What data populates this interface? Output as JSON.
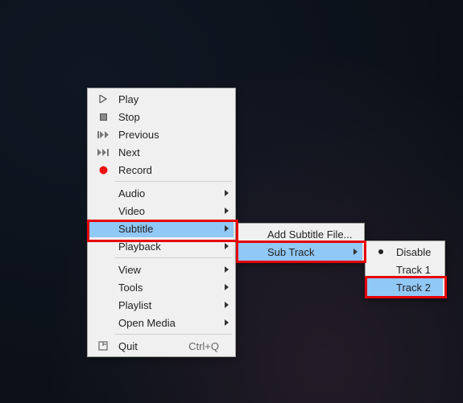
{
  "main_menu": {
    "play": "Play",
    "stop": "Stop",
    "previous": "Previous",
    "next": "Next",
    "record": "Record",
    "audio": "Audio",
    "video": "Video",
    "subtitle": "Subtitle",
    "playback": "Playback",
    "view": "View",
    "tools": "Tools",
    "playlist": "Playlist",
    "open_media": "Open Media",
    "quit": "Quit",
    "quit_shortcut": "Ctrl+Q"
  },
  "subtitle_menu": {
    "add_file": "Add Subtitle File...",
    "sub_track": "Sub Track"
  },
  "subtrack_menu": {
    "disable": "Disable",
    "track1": "Track 1",
    "track2": "Track 2"
  }
}
